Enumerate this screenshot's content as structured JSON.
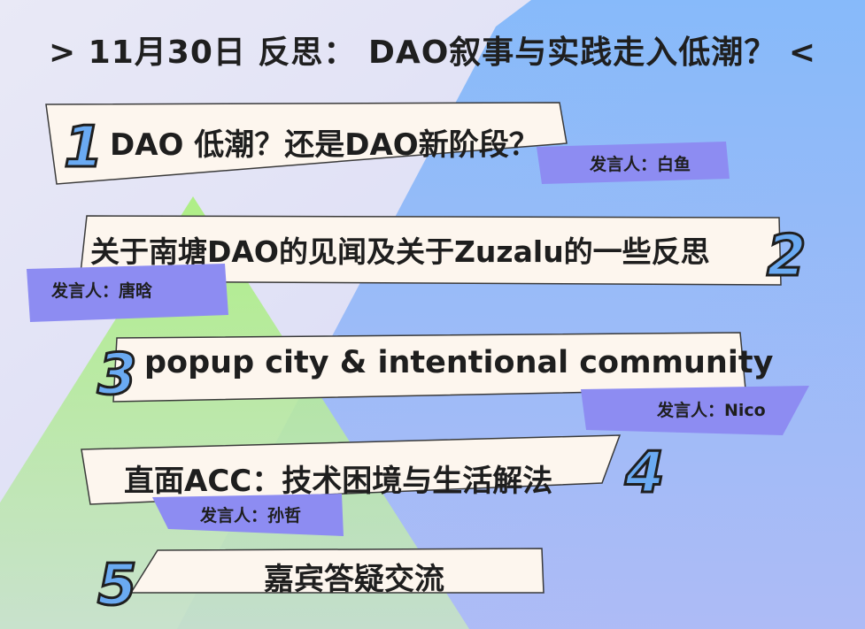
{
  "title": "> 11月30日 反思： DAO叙事与实践走入低潮？ <",
  "colors": {
    "background": "#dcdcf3",
    "triangle_blue": "#8bbaf5",
    "triangle_green": "#b8ee86",
    "banner_fill": "#fdf6ee",
    "speaker_tag": "#8d8cf2",
    "number_fill": "#6aaaf2",
    "text": "#1e1e1e"
  },
  "topics": [
    {
      "number": "1",
      "title": "DAO 低潮？还是DAO新阶段？",
      "speaker": "发言人：白鱼"
    },
    {
      "number": "2",
      "title": "关于南塘DAO的见闻及关于Zuzalu的一些反思",
      "speaker": "发言人：唐晗"
    },
    {
      "number": "3",
      "title": "popup city & intentional community",
      "speaker": "发言人：Nico"
    },
    {
      "number": "4",
      "title": "直面ACC：技术困境与生活解法",
      "speaker": "发言人：孙哲"
    },
    {
      "number": "5",
      "title": "嘉宾答疑交流"
    }
  ]
}
